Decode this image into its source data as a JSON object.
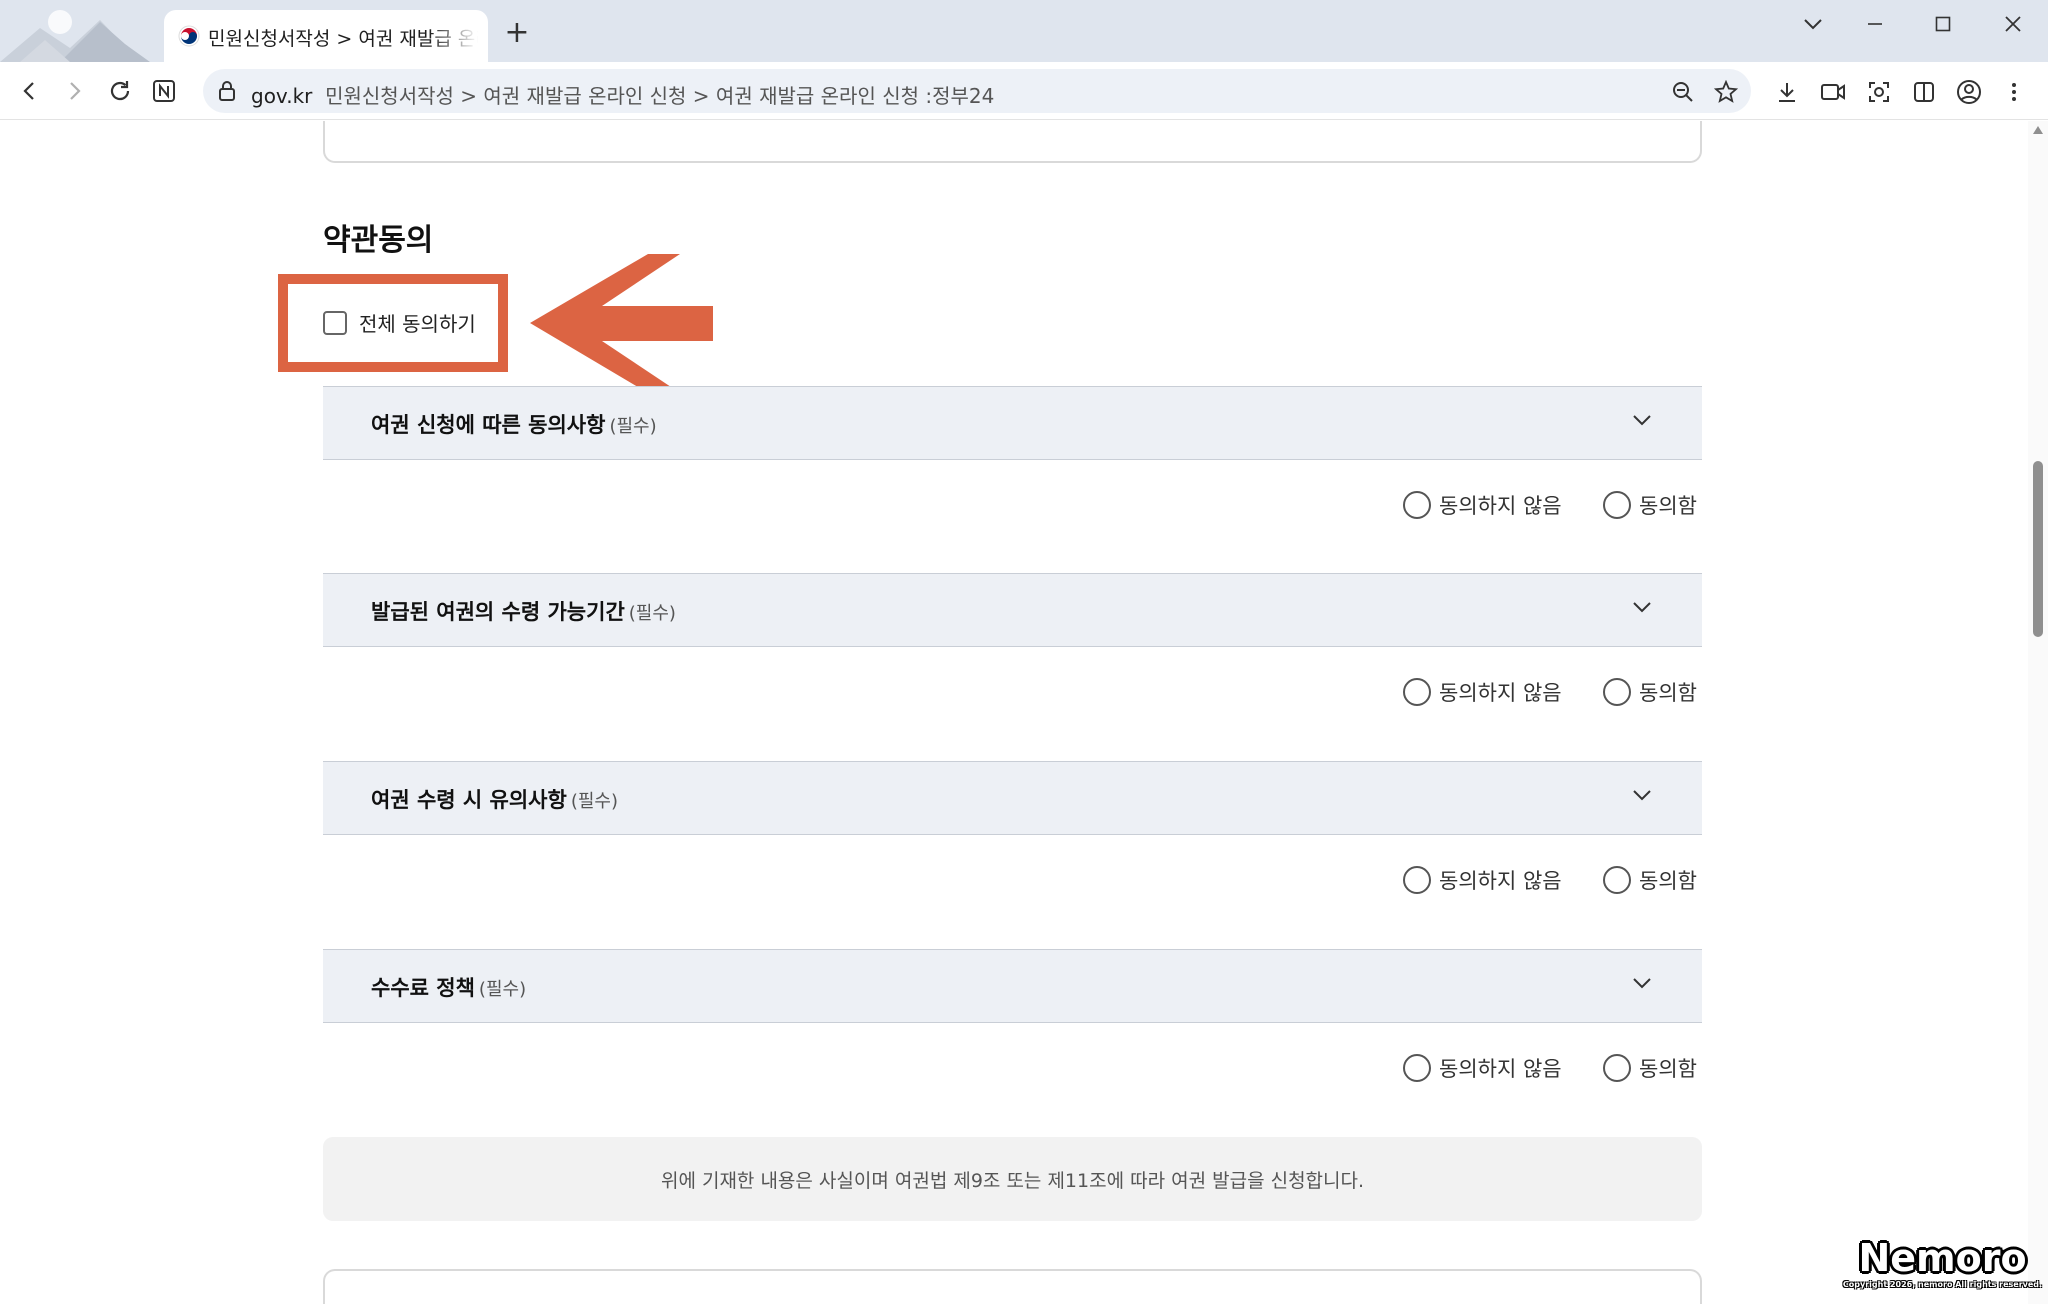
{
  "browser": {
    "tab_title": "민원신청서작성 > 여권 재발급 온라인 신청 :정부24",
    "new_tab": "+",
    "url_host": "gov.kr",
    "url_path": "민원신청서작성 > 여권 재발급 온라인 신청 > 여권 재발급 온라인 신청 :정부24"
  },
  "page": {
    "section_title": "약관동의",
    "agree_all_label": "전체 동의하기",
    "agreements": [
      {
        "title": "여권 신청에 따른 동의사항",
        "required": "(필수)"
      },
      {
        "title": "발급된 여권의 수령 가능기간",
        "required": "(필수)"
      },
      {
        "title": "여권 수령 시 유의사항",
        "required": "(필수)"
      },
      {
        "title": "수수료 정책",
        "required": "(필수)"
      }
    ],
    "radio_labels": {
      "disagree": "동의하지 않음",
      "agree": "동의함"
    },
    "notice": "위에 기재한 내용은 사실이며 여권법 제9조 또는 제11조에 따라 여권 발급을 신청합니다."
  },
  "watermark": {
    "logo": "Nemoro",
    "copyright": "Copyright 2026, nemoro All rights reserved."
  },
  "colors": {
    "highlight": "#dc6443",
    "accordion_bg": "#edf0f5",
    "notice_bg": "#f2f2f2"
  }
}
